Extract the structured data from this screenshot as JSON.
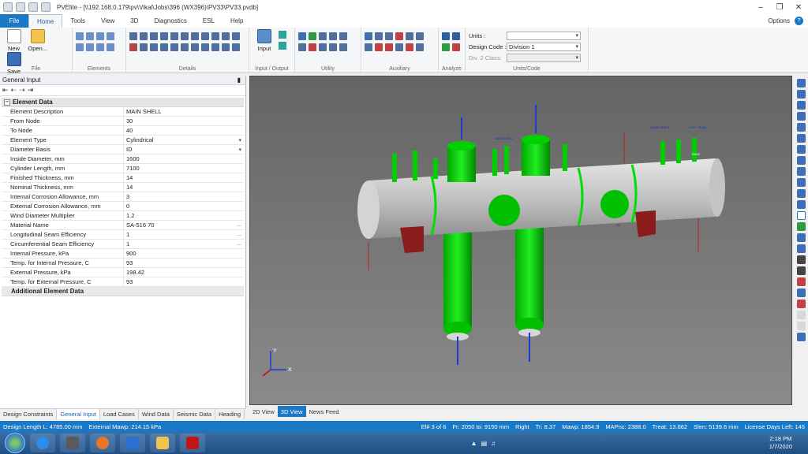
{
  "window": {
    "title": "PVElite - [\\\\192.168.0.179\\pv\\Vikal\\Jobs\\396 (WX396)\\PV33\\PV33.pvdb]"
  },
  "menu": {
    "file": "File",
    "tabs": [
      "Home",
      "Tools",
      "View",
      "3D",
      "Diagnostics",
      "ESL",
      "Help"
    ],
    "options": "Options"
  },
  "ribbon": {
    "file_group": {
      "label": "File",
      "new": "New",
      "open": "Open...",
      "save": "Save"
    },
    "elements_label": "Elements",
    "details_label": "Details",
    "io_group": {
      "label": "Input / Output",
      "input": "Input"
    },
    "utility_label": "Utility",
    "auxiliary_label": "Auxiliary",
    "analyze_label": "Analyze",
    "units_group": {
      "label": "Units/Code",
      "units_label": "Units :",
      "units_value": "",
      "design_code_label": "Design Code :",
      "design_code_value": "Division 1",
      "div2_label": "Div. 2 Class:",
      "div2_value": ""
    }
  },
  "left_panel": {
    "title": "General Input",
    "section": "Element Data",
    "rows": [
      {
        "k": "Element Description",
        "v": "MAIN SHELL"
      },
      {
        "k": "From Node",
        "v": "30"
      },
      {
        "k": "To Node",
        "v": "40"
      },
      {
        "k": "Element Type",
        "v": "Cylindrical"
      },
      {
        "k": "Diameter Basis",
        "v": "ID"
      },
      {
        "k": "Inside Diameter, mm",
        "v": "1600"
      },
      {
        "k": "Cylinder Length, mm",
        "v": "7100"
      },
      {
        "k": "Finished Thickness, mm",
        "v": "14"
      },
      {
        "k": "Nominal Thickness, mm",
        "v": "14"
      },
      {
        "k": "Internal Corrosion Allowance, mm",
        "v": "3"
      },
      {
        "k": "External Corrosion Allowance, mm",
        "v": "0"
      },
      {
        "k": "Wind Diameter Multiplier",
        "v": "1.2"
      },
      {
        "k": "Material Name",
        "v": "SA-516 70"
      },
      {
        "k": "Longitudinal Seam Efficiency",
        "v": "1"
      },
      {
        "k": "Circumferential Seam Efficiency",
        "v": "1"
      },
      {
        "k": "Internal Pressure, kPa",
        "v": "900"
      },
      {
        "k": "Temp. for Internal Pressure, C",
        "v": "93"
      },
      {
        "k": "External Pressure, kPa",
        "v": "198.42"
      },
      {
        "k": "Temp. for External Pressure, C",
        "v": "93"
      }
    ],
    "subsection": "Additional Element Data",
    "tabs": [
      "Design Constraints",
      "General Input",
      "Load Cases",
      "Wind Data",
      "Seismic Data",
      "Heading"
    ]
  },
  "view_tabs": [
    "2D View",
    "3D View",
    "News Feed"
  ],
  "viewport": {
    "labels": {
      "main_shell_1": "MAIN SHELL",
      "main_shell_2": "MAIN SHELL",
      "left_head": "LEFT HEAD",
      "ring": "RING",
      "nozzle_tag": "N2",
      "y_axis": "Y",
      "x_axis": "X"
    }
  },
  "status": {
    "design_length": "Design Length L: 4785.00 mm",
    "external_mawp": "External Mawp: 214.15 kPa",
    "el": "El# 3 of 6",
    "fr": "Fr: 2050 to: 9150 mm",
    "dir": "Right",
    "tr": "Tr: 8.37",
    "mawp": "Mawp: 1854.9",
    "mapnc": "MAPnc: 2388.0",
    "treat": "Treat: 13.662",
    "slen": "Slen: 5139.6 mm",
    "license": "License Days Left: 145"
  },
  "taskbar": {
    "time": "2:18 PM",
    "date": "1/7/2020"
  },
  "colors": {
    "accent": "#1b78c4",
    "vessel": "#00d000",
    "shell": "#c9c9c9"
  }
}
